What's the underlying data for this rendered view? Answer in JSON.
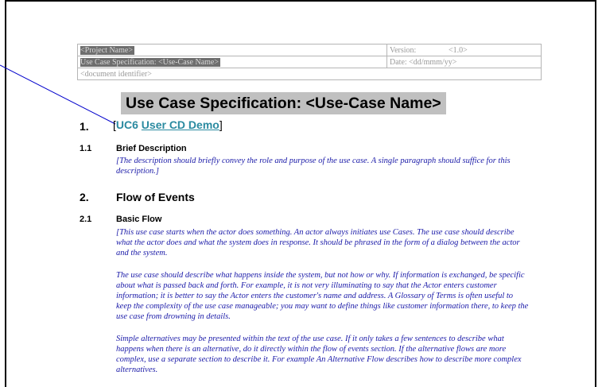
{
  "header": {
    "project_name": "<Project Name>",
    "version_label": "Version:",
    "version_value": "<1.0>",
    "spec_label": "Use Case Specification: <Use-Case Name>",
    "date_label": "Date:",
    "date_value": "<dd/mmm/yy>",
    "doc_identifier": "<document identifier>"
  },
  "title": "Use Case Specification: <Use-Case Name>",
  "section1": {
    "number": "1.",
    "open_bracket": "[",
    "uc_id": "UC6",
    "uc_name": "User CD Demo",
    "close_bracket": "]"
  },
  "section1_1": {
    "number": "1.1",
    "title": "Brief Description",
    "text": "[The description should briefly convey the role and purpose of the use case.  A single paragraph should suffice for this description.]"
  },
  "section2": {
    "number": "2.",
    "title": "Flow of Events"
  },
  "section2_1": {
    "number": "2.1",
    "title": "Basic Flow",
    "paragraphs": [
      "[This use case starts when the actor does something.  An actor always initiates use Cases.  The use case should describe what the actor does and what the system does in response.  It should be phrased in the form of a dialog between the actor and the system.",
      "The use case should describe what happens inside the system, but not how or why.  If information is exchanged, be specific about what is passed back and forth.  For example, it is not very illuminating to say that the Actor enters customer information; it is better to say the Actor enters the customer's name and address.  A Glossary of Terms is often useful to keep the complexity of the use case manageable; you may want to define things like customer information there, to keep the use case from drowning in details.",
      "Simple alternatives may be presented within the text of the use case.  If it only takes a few sentences to describe what happens when there is an alternative, do it directly within the flow of events section.  If the alternative flows are more complex, use a separate section to describe it.  For example An Alternative Flow describes how to describe more complex alternatives."
    ]
  },
  "colors": {
    "instruction_text": "#1a1aa8",
    "link": "#2a8aa0",
    "title_highlight": "#c0c0c0",
    "callout_line": "#0000cc"
  }
}
